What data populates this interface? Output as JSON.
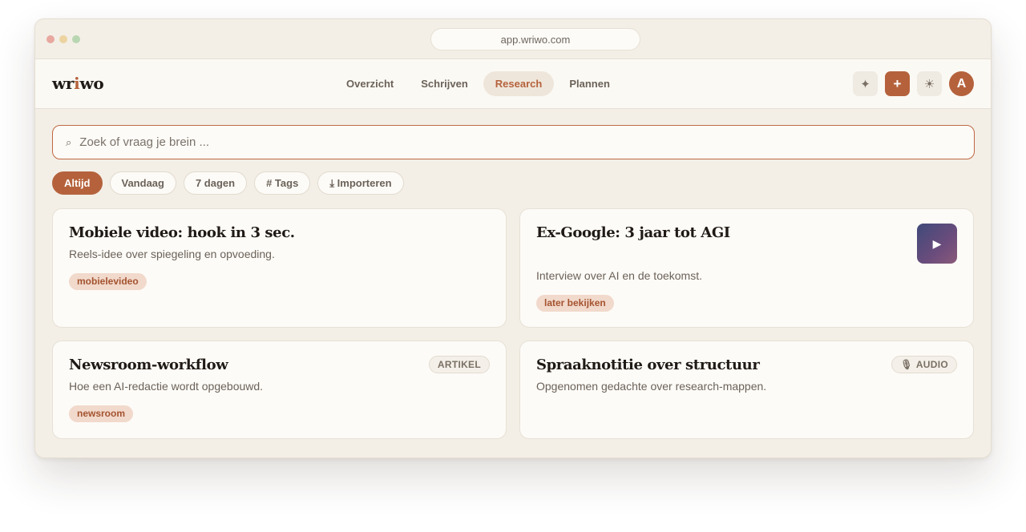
{
  "browser": {
    "url": "app.wriwo.com"
  },
  "header": {
    "logo_pre": "wr",
    "logo_i": "i",
    "logo_post": "wo",
    "nav": [
      {
        "label": "Overzicht"
      },
      {
        "label": "Schrijven"
      },
      {
        "label": "Research",
        "active": true
      },
      {
        "label": "Plannen"
      }
    ],
    "actions": {
      "sparkle_glyph": "✦",
      "add_glyph": "+",
      "theme_glyph": "☀",
      "avatar_initial": "A"
    }
  },
  "search": {
    "icon_glyph": "⌕",
    "placeholder": "Zoek of vraag je brein ..."
  },
  "filters": [
    {
      "label": "Altijd",
      "active": true
    },
    {
      "label": "Vandaag"
    },
    {
      "label": "7 dagen"
    },
    {
      "label": "# Tags"
    },
    {
      "label": "⤓ Importeren"
    }
  ],
  "cards": [
    {
      "title": "Mobiele video: hook in 3 sec.",
      "description": "Reels-idee over spiegeling en opvoeding.",
      "tag": "mobielevideo"
    },
    {
      "title": "Ex-Google: 3 jaar tot AGI",
      "description": "Interview over AI en de toekomst.",
      "tag": "later bekijken",
      "thumb_glyph": "▶"
    },
    {
      "title": "Newsroom-workflow",
      "description": "Hoe een AI-redactie wordt opgebouwd.",
      "tag": "newsroom",
      "badge": "ARTIKEL"
    },
    {
      "title": "Spraaknotitie over structuur",
      "description": "Opgenomen gedachte over research-mappen.",
      "badge_icon": "🎙",
      "badge": "AUDIO"
    }
  ],
  "colors": {
    "accent": "#b5623c",
    "background": "#f3efe7",
    "card": "#fdfbf7",
    "tag_bg": "#f1d9cc"
  }
}
